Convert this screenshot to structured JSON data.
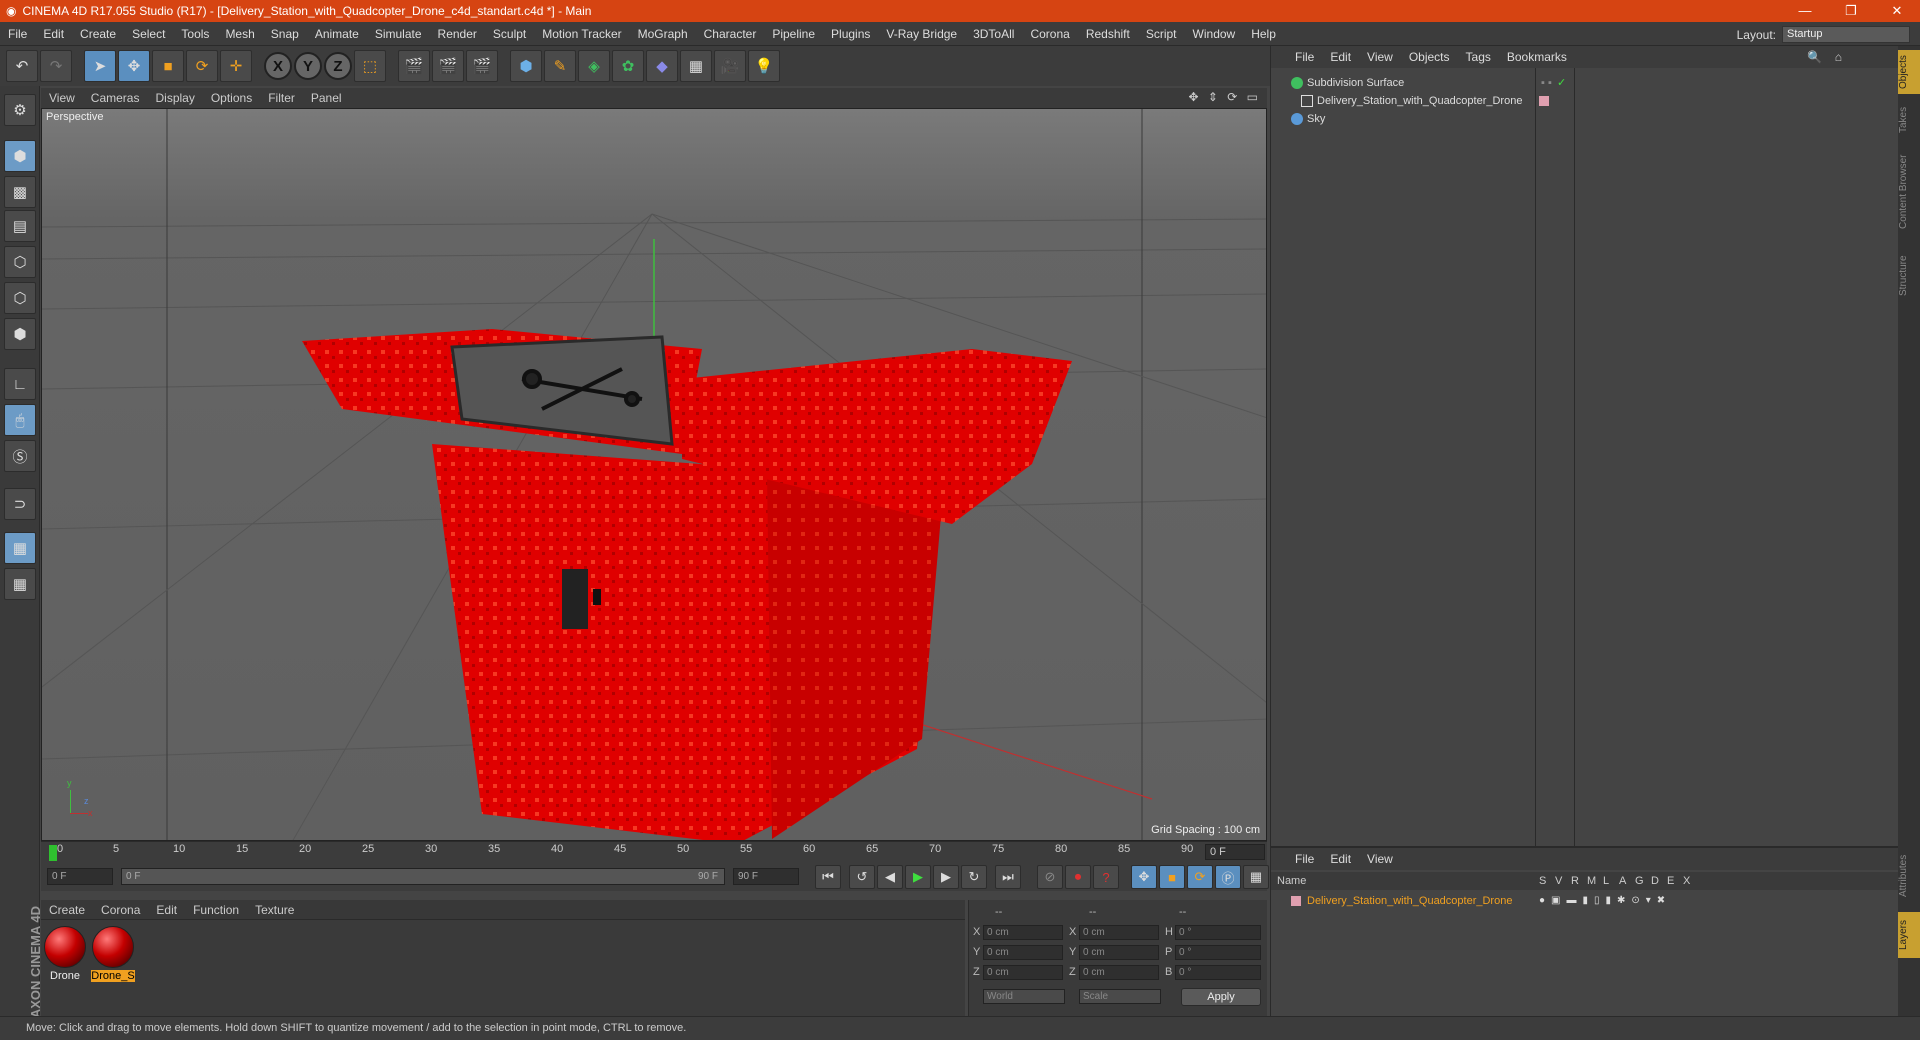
{
  "window": {
    "title": "CINEMA 4D R17.055 Studio (R17) - [Delivery_Station_with_Quadcopter_Drone_c4d_standart.c4d *] - Main",
    "minimize": "—",
    "restore": "❐",
    "close": "✕"
  },
  "menubar": {
    "items": [
      "File",
      "Edit",
      "Create",
      "Select",
      "Tools",
      "Mesh",
      "Snap",
      "Animate",
      "Simulate",
      "Render",
      "Sculpt",
      "Motion Tracker",
      "MoGraph",
      "Character",
      "Pipeline",
      "Plugins",
      "V-Ray Bridge",
      "3DToAll",
      "Corona",
      "Redshift",
      "Script",
      "Window",
      "Help"
    ]
  },
  "layout": {
    "label": "Layout:",
    "value": "Startup"
  },
  "toolbar": {
    "x": "X",
    "y": "Y",
    "z": "Z"
  },
  "viewport": {
    "menu": [
      "View",
      "Cameras",
      "Display",
      "Options",
      "Filter",
      "Panel"
    ],
    "nav_icons": "✥ ⇕ ⟳ ▭",
    "label": "Perspective",
    "grid_spacing": "Grid Spacing : 100 cm",
    "axis_y": "y",
    "axis_x": "x",
    "axis_z": "z"
  },
  "timeline": {
    "ticks": [
      "0",
      "5",
      "10",
      "15",
      "20",
      "25",
      "30",
      "35",
      "40",
      "45",
      "50",
      "55",
      "60",
      "65",
      "70",
      "75",
      "80",
      "85",
      "90"
    ],
    "current_frame": "0 F"
  },
  "playback": {
    "start": "0 F",
    "range_start": "0 F",
    "range_end": "90 F",
    "end": "90 F"
  },
  "materials": {
    "menu": [
      "Create",
      "Corona",
      "Edit",
      "Function",
      "Texture"
    ],
    "items": [
      {
        "name": "Drone"
      },
      {
        "name": "Drone_S"
      }
    ]
  },
  "coordinates": {
    "headers": [
      "--",
      "--",
      "--"
    ],
    "rows": [
      {
        "a": "X",
        "av": "0 cm",
        "b": "X",
        "bv": "0 cm",
        "c": "H",
        "cv": "0 °"
      },
      {
        "a": "Y",
        "av": "0 cm",
        "b": "Y",
        "bv": "0 cm",
        "c": "P",
        "cv": "0 °"
      },
      {
        "a": "Z",
        "av": "0 cm",
        "b": "Z",
        "bv": "0 cm",
        "c": "B",
        "cv": "0 °"
      }
    ],
    "space": "World",
    "mode": "Scale",
    "apply": "Apply"
  },
  "branding": {
    "line1": "MAXON",
    "line2": "CINEMA 4D"
  },
  "status": {
    "text": "Move: Click and drag to move elements. Hold down SHIFT to quantize movement / add to the selection in point mode, CTRL to remove."
  },
  "objects": {
    "menu": [
      "File",
      "Edit",
      "View",
      "Objects",
      "Tags",
      "Bookmarks"
    ],
    "rows": [
      {
        "name": "Subdivision Surface",
        "color": "#3fbf5f"
      },
      {
        "name": "Delivery_Station_with_Quadcopter_Drone",
        "color": "#dddddd"
      },
      {
        "name": "Sky",
        "color": "#5a9ad8"
      }
    ]
  },
  "layers": {
    "menu": [
      "File",
      "Edit",
      "View"
    ],
    "header_name": "Name",
    "columns": [
      "S",
      "V",
      "R",
      "M",
      "L",
      "A",
      "G",
      "D",
      "E",
      "X"
    ],
    "rows": [
      {
        "name": "Delivery_Station_with_Quadcopter_Drone",
        "color": "#f0a020"
      }
    ]
  },
  "sidetabs": [
    "Objects",
    "Takes",
    "Content Browser",
    "Structure",
    "Attributes",
    "Layers"
  ]
}
